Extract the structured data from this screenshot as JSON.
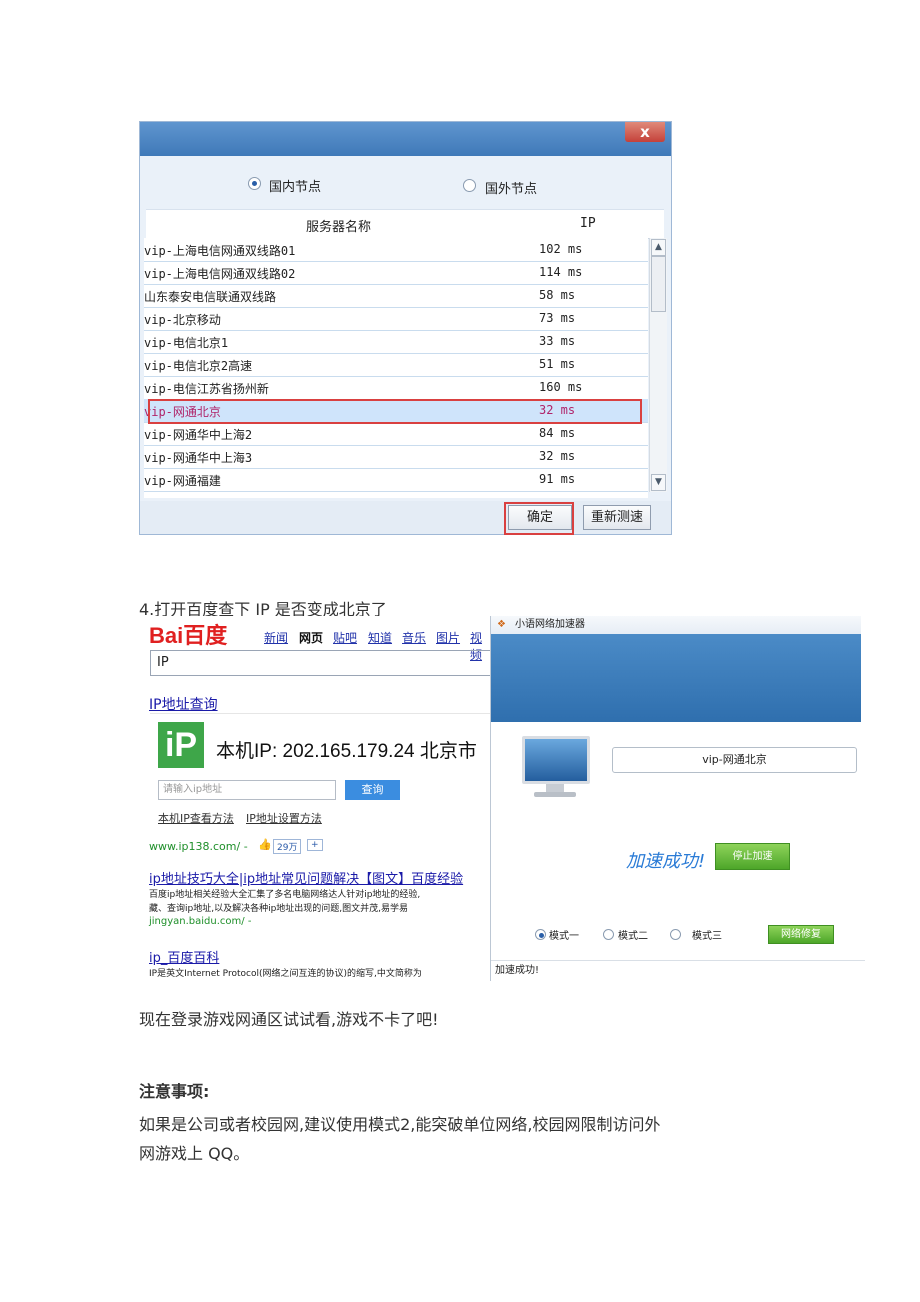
{
  "dialog": {
    "close_label": "x",
    "radio_domestic": "国内节点",
    "radio_foreign": "国外节点",
    "col_server": "服务器名称",
    "col_ip": "IP",
    "rows": [
      {
        "name": "vip-上海电信网通双线路01",
        "ping": "102 ms"
      },
      {
        "name": "vip-上海电信网通双线路02",
        "ping": "114 ms"
      },
      {
        "name": "山东泰安电信联通双线路",
        "ping": "58 ms"
      },
      {
        "name": "vip-北京移动",
        "ping": "73 ms"
      },
      {
        "name": "vip-电信北京1",
        "ping": "33 ms"
      },
      {
        "name": "vip-电信北京2高速",
        "ping": "51 ms"
      },
      {
        "name": "vip-电信江苏省扬州新",
        "ping": "160 ms"
      },
      {
        "name": "vip-网通北京",
        "ping": "32 ms"
      },
      {
        "name": "vip-网通华中上海2",
        "ping": "84 ms"
      },
      {
        "name": "vip-网通华中上海3",
        "ping": "32 ms"
      },
      {
        "name": "vip-网通福建",
        "ping": "91 ms"
      }
    ],
    "selected_index": 7,
    "ok_label": "确定",
    "retest_label": "重新测速"
  },
  "step4": "4.打开百度查下 IP 是否变成北京了",
  "baidu": {
    "logo": "Bai百度",
    "nav": [
      "新闻",
      "网页",
      "贴吧",
      "知道",
      "音乐",
      "图片",
      "视频"
    ],
    "search_value": "IP",
    "result1_title": "IP地址查询",
    "ip_icon": "iP",
    "ip_line": "本机IP: 202.165.179.24  北京市",
    "ip_placeholder": "请输入ip地址",
    "query_label": "查询",
    "help1": "本机IP查看方法",
    "help2": "IP地址设置方法",
    "site1": "www.ip138.com/ -",
    "likes": "29万",
    "plus": "+",
    "result2_title": "ip地址技巧大全|ip地址常见问题解决【图文】百度经验",
    "result2_desc1": "百度ip地址相关经验大全汇集了多名电脑网络达人针对ip地址的经验,",
    "result2_desc2": "藏、查询ip地址,以及解决各种ip地址出现的问题,图文并茂,易学易",
    "site2": "jingyan.baidu.com/ -",
    "result3_title": "ip_百度百科",
    "result3_desc": "IP是英文Internet Protocol(网络之间互连的协议)的缩写,中文简称为"
  },
  "app": {
    "title": "小语网络加速器",
    "node_value": "vip-网通北京",
    "success": "加速成功!",
    "stop_label": "停止加速",
    "modes": [
      "模式一",
      "模式二",
      "模式三"
    ],
    "repair_label": "网络修复",
    "status": "加速成功!"
  },
  "text_login": "现在登录游戏网通区试试看,游戏不卡了吧!",
  "notes_heading": "注意事项:",
  "notes_line1": "如果是公司或者校园网,建议使用模式2,能突破单位网络,校园网限制访问外",
  "notes_line2": "网游戏上 QQ。"
}
